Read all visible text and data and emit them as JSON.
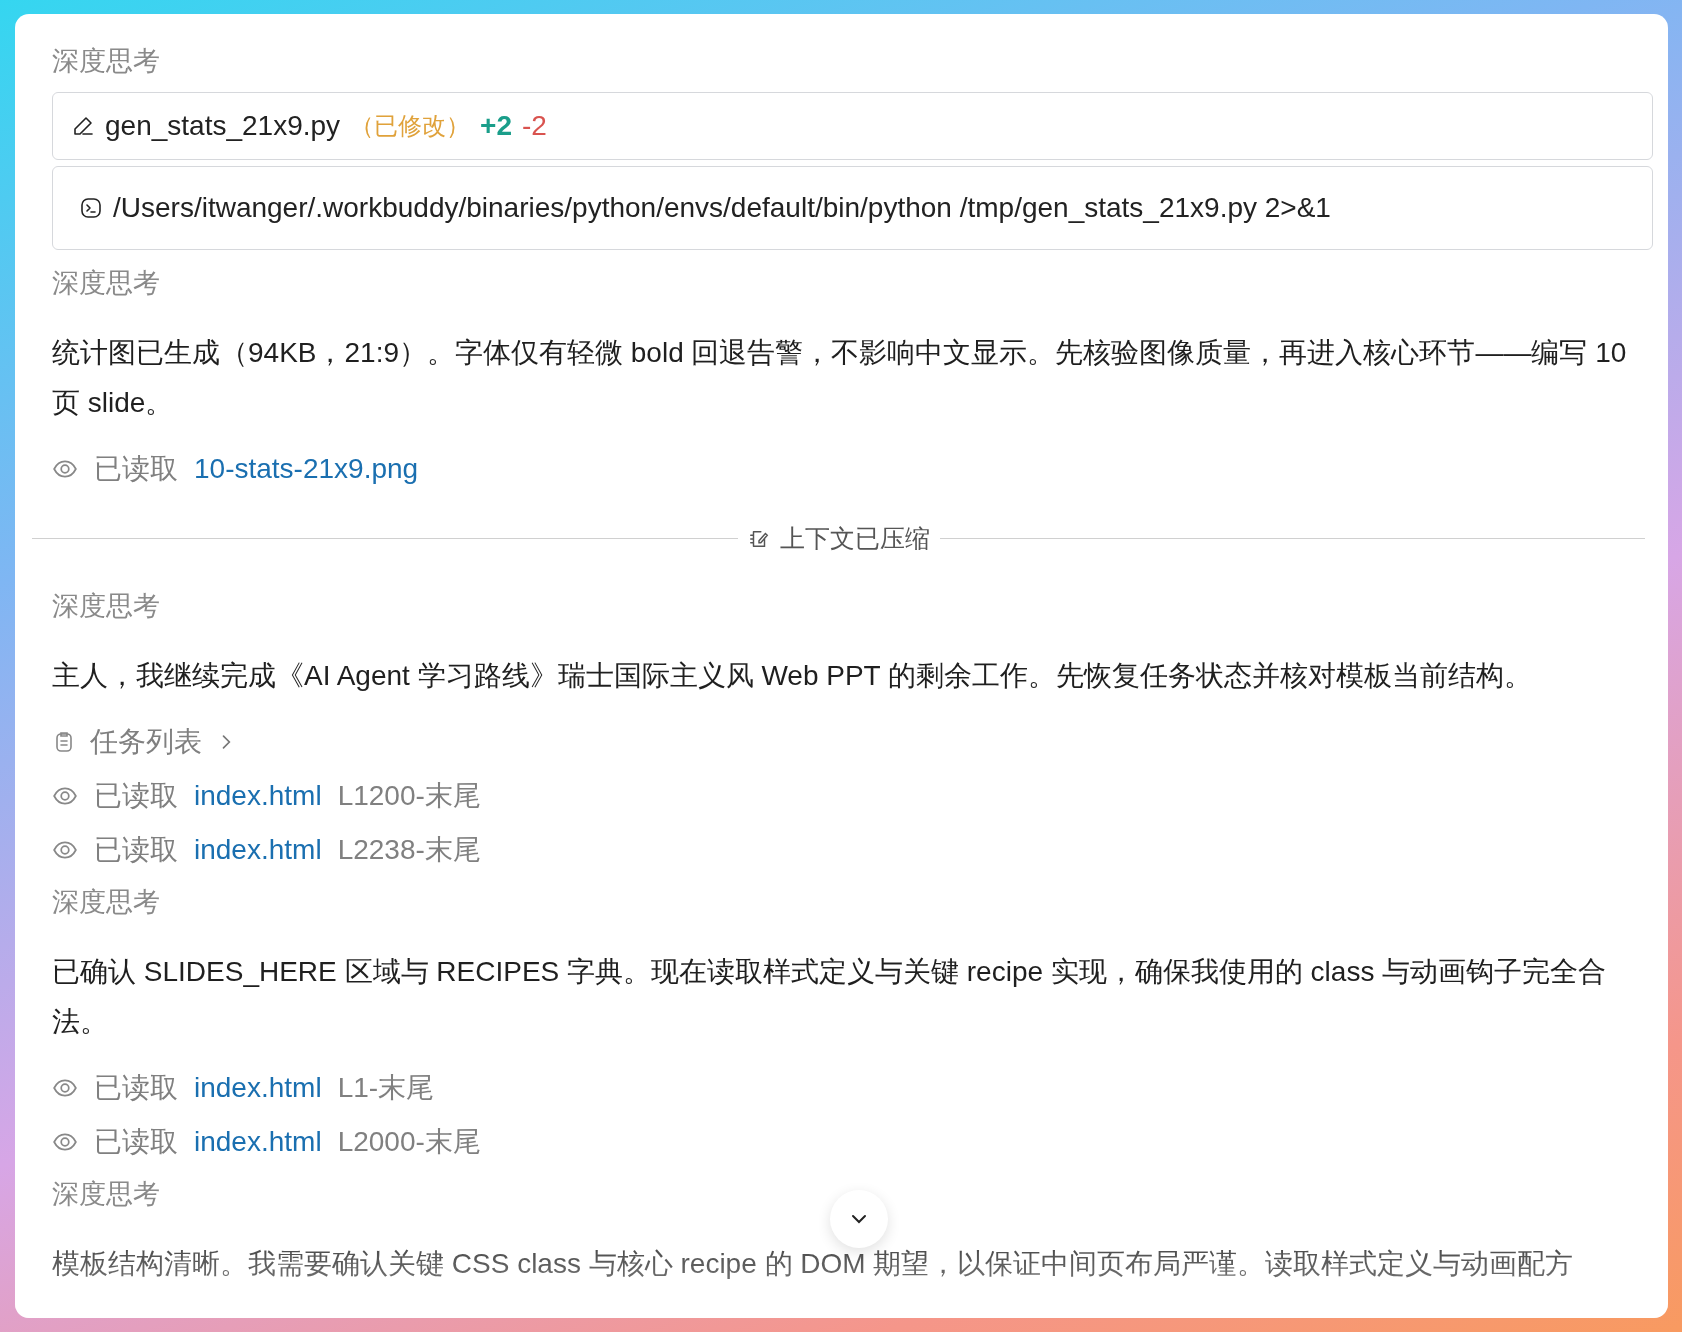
{
  "items": [
    {
      "kind": "thinking",
      "label": "深度思考"
    },
    {
      "kind": "edit",
      "file": "gen_stats_21x9.py",
      "status": "（已修改）",
      "added": "+2",
      "removed": "-2"
    },
    {
      "kind": "command",
      "text": "/Users/itwanger/.workbuddy/binaries/python/envs/default/bin/python /tmp/gen_stats_21x9.py 2>&1"
    },
    {
      "kind": "thinking",
      "label": "深度思考"
    },
    {
      "kind": "paragraph",
      "text": "统计图已生成（94KB，21:9）。字体仅有轻微 bold 回退告警，不影响中文显示。先核验图像质量，再进入核心环节——编写 10 页 slide。"
    },
    {
      "kind": "read",
      "label": "已读取",
      "file": "10-stats-21x9.png"
    },
    {
      "kind": "divider",
      "label": "上下文已压缩"
    },
    {
      "kind": "thinking",
      "label": "深度思考"
    },
    {
      "kind": "paragraph",
      "text": "主人，我继续完成《AI Agent 学习路线》瑞士国际主义风 Web PPT 的剩余工作。先恢复任务状态并核对模板当前结构。"
    },
    {
      "kind": "tasks",
      "label": "任务列表",
      "expanded": false
    },
    {
      "kind": "read",
      "label": "已读取",
      "file": "index.html",
      "range": "L1200-末尾"
    },
    {
      "kind": "read",
      "label": "已读取",
      "file": "index.html",
      "range": "L2238-末尾"
    },
    {
      "kind": "thinking",
      "label": "深度思考"
    },
    {
      "kind": "paragraph",
      "text": "已确认 SLIDES_HERE 区域与 RECIPES 字典。现在读取样式定义与关键 recipe 实现，确保我使用的 class 与动画钩子完全合法。"
    },
    {
      "kind": "read",
      "label": "已读取",
      "file": "index.html",
      "range": "L1-末尾"
    },
    {
      "kind": "read",
      "label": "已读取",
      "file": "index.html",
      "range": "L2000-末尾"
    },
    {
      "kind": "thinking",
      "label": "深度思考"
    },
    {
      "kind": "paragraph",
      "text": "模板结构清晰。我需要确认关键 CSS class 与核心 recipe 的 DOM 期望，以保证中间页布局严谨。读取样式定义与动画配方"
    }
  ]
}
